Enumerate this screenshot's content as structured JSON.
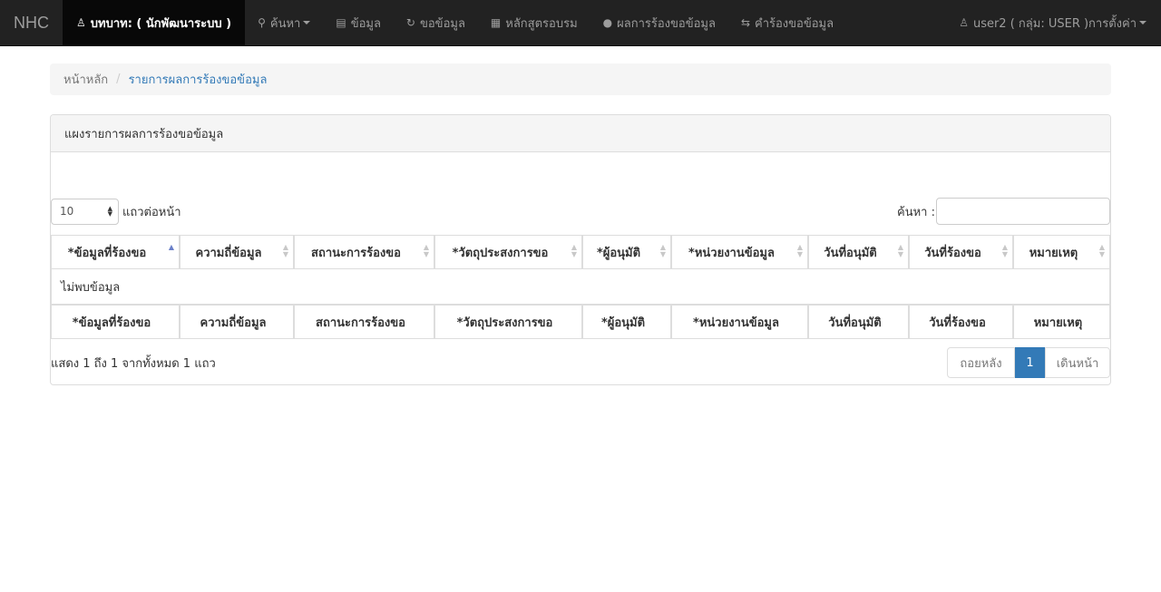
{
  "navbar": {
    "brand": "NHC",
    "role": "บทบาท: ( นักพัฒนาระบบ )",
    "items": [
      {
        "label": "ค้นหา",
        "icon": "search-icon",
        "dropdown": true
      },
      {
        "label": "ข้อมูล",
        "icon": "hdd-icon",
        "dropdown": false
      },
      {
        "label": "ขอข้อมูล",
        "icon": "refresh-icon",
        "dropdown": false
      },
      {
        "label": "หลักสูตรอบรม",
        "icon": "calendar-icon",
        "dropdown": false
      },
      {
        "label": "ผลการร้องขอข้อมูล",
        "icon": "comment-icon",
        "dropdown": false
      },
      {
        "label": "คำร้องขอข้อมูล",
        "icon": "transfer-icon",
        "dropdown": false
      }
    ],
    "user_label": "user2 ( กลุ่ม: USER )การตั้งค่า"
  },
  "breadcrumb": {
    "home": "หน้าหลัก",
    "separator": "/",
    "current": "รายการผลการร้องขอข้อมูล"
  },
  "panel": {
    "title": "แผงรายการผลการร้องขอข้อมูล"
  },
  "table_controls": {
    "page_length": "10",
    "length_label": "แถวต่อหน้า",
    "search_label": "ค้นหา :",
    "search_value": ""
  },
  "table": {
    "columns": [
      "*ข้อมูลที่ร้องขอ",
      "ความถี่ข้อมูล",
      "สถานะการร้องขอ",
      "*วัตถุประสงการขอ",
      "*ผู้อนุมัติ",
      "*หน่วยงานข้อมูล",
      "วันที่อนุมัติ",
      "วันที่ร้องขอ",
      "หมายเหตุ"
    ],
    "sorted_column": "*ข้อมูลที่ร้องขอ",
    "empty_message": "ไม่พบข้อมูล"
  },
  "footer": {
    "info": "แสดง 1 ถึง 1 จากทั้งหมด 1 แถว",
    "prev": "ถอยหลัง",
    "current_page": "1",
    "next": "เดินหน้า"
  },
  "colors": {
    "navbar_bg": "#222222",
    "accent": "#337ab7"
  }
}
